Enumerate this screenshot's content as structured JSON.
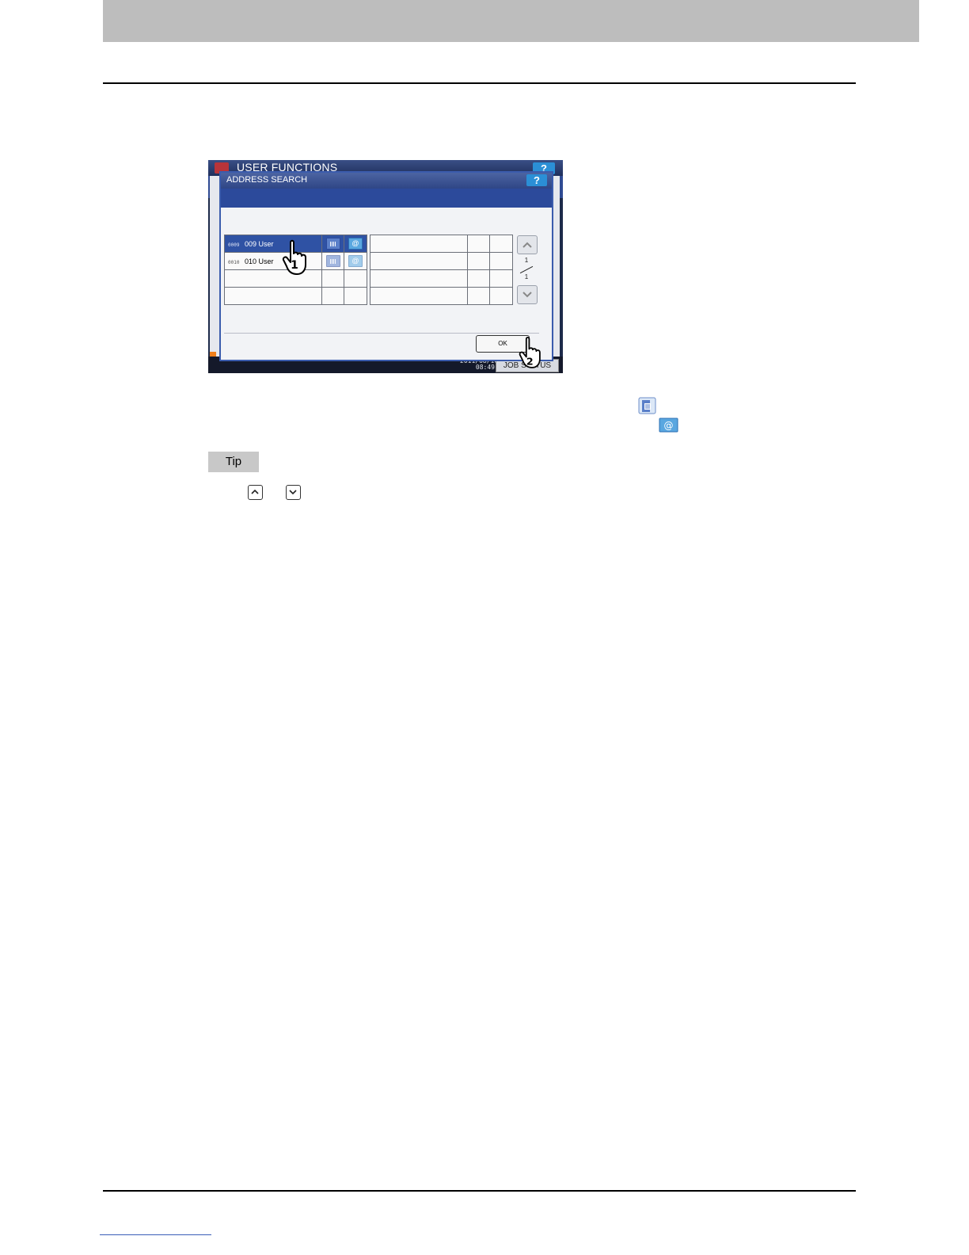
{
  "screen": {
    "app_title": "USER FUNCTIONS",
    "app_help_label": "?",
    "dialog": {
      "title": "ADDRESS SEARCH",
      "help_label": "?",
      "rows": [
        {
          "number": "0009",
          "name": "009 User",
          "selected": true
        },
        {
          "number": "0010",
          "name": "010 User",
          "selected": false
        }
      ],
      "page_current": "1",
      "page_total": "1",
      "ok_label": "OK"
    },
    "footer": {
      "date": "2011/08/10",
      "time": "08:49",
      "job_status_label": "JOB STATUS"
    },
    "callouts": [
      "1",
      "2"
    ]
  },
  "icons": {
    "fax": "fax-icon",
    "email": "email-icon",
    "up": "up-arrow-icon",
    "down": "down-arrow-icon"
  },
  "tip": {
    "label": "Tip"
  },
  "colors": {
    "header_band": "#bdbdbd",
    "dialog_blue": "#2c4a9b",
    "selection_blue": "#2f52a4",
    "help_button": "#2b8fd6"
  }
}
